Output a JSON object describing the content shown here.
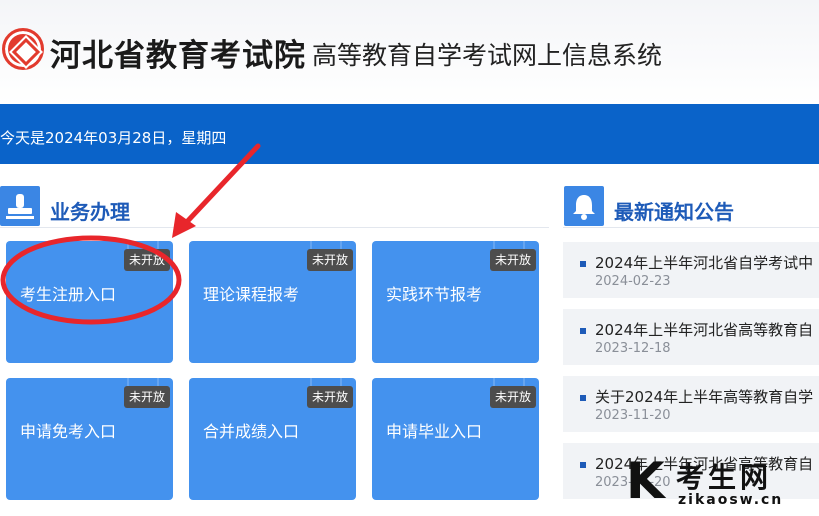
{
  "header": {
    "org_name": "河北省教育考试院",
    "system_name": "高等教育自学考试网上信息系统"
  },
  "banner": {
    "date_text": "今天是2024年03月28日，星期四"
  },
  "services": {
    "title": "业务办理",
    "icon": "stamp-icon",
    "tiles": [
      {
        "label": "考生注册入口",
        "badge": "未开放"
      },
      {
        "label": "理论课程报考",
        "badge": "未开放"
      },
      {
        "label": "实践环节报考",
        "badge": "未开放"
      },
      {
        "label": "申请免考入口",
        "badge": "未开放"
      },
      {
        "label": "合并成绩入口",
        "badge": "未开放"
      },
      {
        "label": "申请毕业入口",
        "badge": "未开放"
      }
    ]
  },
  "notices": {
    "title": "最新通知公告",
    "icon": "bell-icon",
    "items": [
      {
        "title": "2024年上半年河北省自学考试中",
        "date": "2024-02-23"
      },
      {
        "title": "2024年上半年河北省高等教育自",
        "date": "2023-12-18"
      },
      {
        "title": "关于2024年上半年高等教育自学",
        "date": "2023-11-20"
      },
      {
        "title": "2024年上半年河北省高等教育自",
        "date": "2023-11-20"
      }
    ]
  },
  "watermark": {
    "letter": "K",
    "text": "考生网",
    "url": "zikaosw.cn"
  },
  "colors": {
    "brand_blue": "#0a63c9",
    "tile_blue": "#4492ee",
    "title_blue": "#1e5bb8",
    "annotation_red": "#e8262b"
  }
}
